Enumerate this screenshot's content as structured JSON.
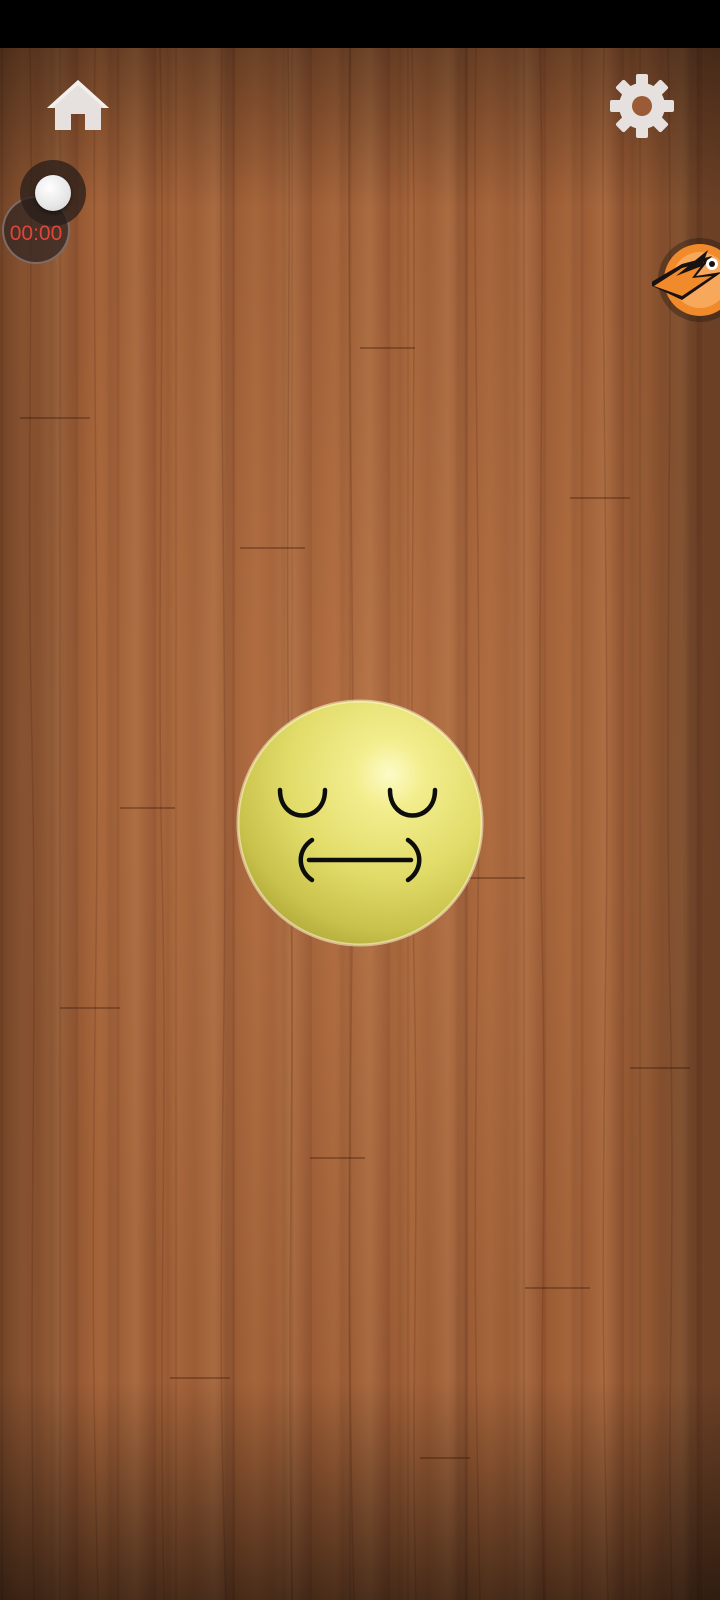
{
  "theme": {
    "wood_color": "#a0603a",
    "ball_color": "#e9e57a",
    "timer_text_color": "#e0453a",
    "badge_color": "#f08a2a",
    "icon_color": "#e6e1df"
  },
  "toolbar": {
    "home_icon": "home-icon",
    "settings_icon": "gear-icon"
  },
  "timer": {
    "display": "00:00",
    "toggle_on": false
  },
  "side_badge": {
    "icon": "ninja-badge-icon"
  },
  "character": {
    "icon": "sleepy-face-ball",
    "expression": "eyes-closed-clenched-mouth"
  }
}
